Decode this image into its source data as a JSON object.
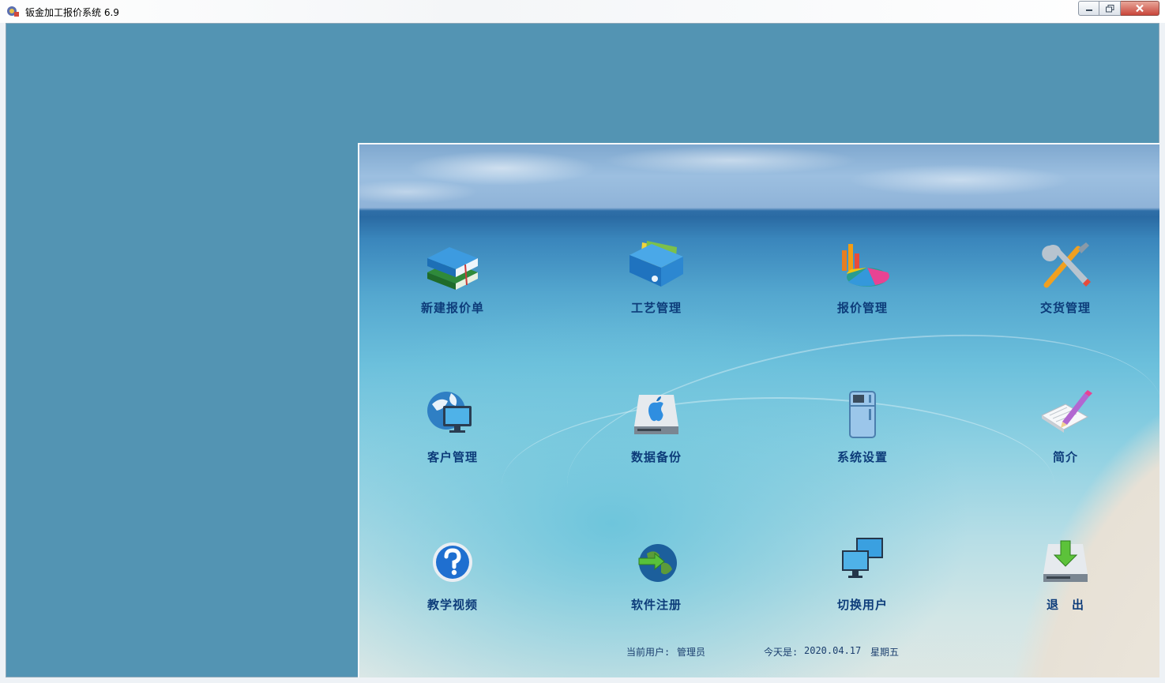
{
  "window": {
    "title": "钣金加工报价系统 6.9",
    "controls": [
      "minimize",
      "maximize",
      "close"
    ]
  },
  "colors": {
    "client_bg": "#5394b3",
    "label": "#0d3c7a"
  },
  "menu": [
    {
      "label": "新建报价单",
      "icon": "books-icon"
    },
    {
      "label": "工艺管理",
      "icon": "binder-icon"
    },
    {
      "label": "报价管理",
      "icon": "pie-chart-icon"
    },
    {
      "label": "交货管理",
      "icon": "tools-icon"
    },
    {
      "label": "客户管理",
      "icon": "globe-monitor-icon"
    },
    {
      "label": "数据备份",
      "icon": "apple-drive-icon"
    },
    {
      "label": "系统设置",
      "icon": "fridge-icon"
    },
    {
      "label": "简介",
      "icon": "notepad-pen-icon"
    },
    {
      "label": "教学视频",
      "icon": "help-icon"
    },
    {
      "label": "软件注册",
      "icon": "earth-arrow-icon"
    },
    {
      "label": "切换用户",
      "icon": "monitors-icon"
    },
    {
      "label": "退　出",
      "icon": "download-drive-icon"
    }
  ],
  "status": {
    "user_label": "当前用户:",
    "user_value": "管理员",
    "date_label": "今天是:",
    "date_value": "2020.04.17",
    "weekday": "星期五"
  }
}
